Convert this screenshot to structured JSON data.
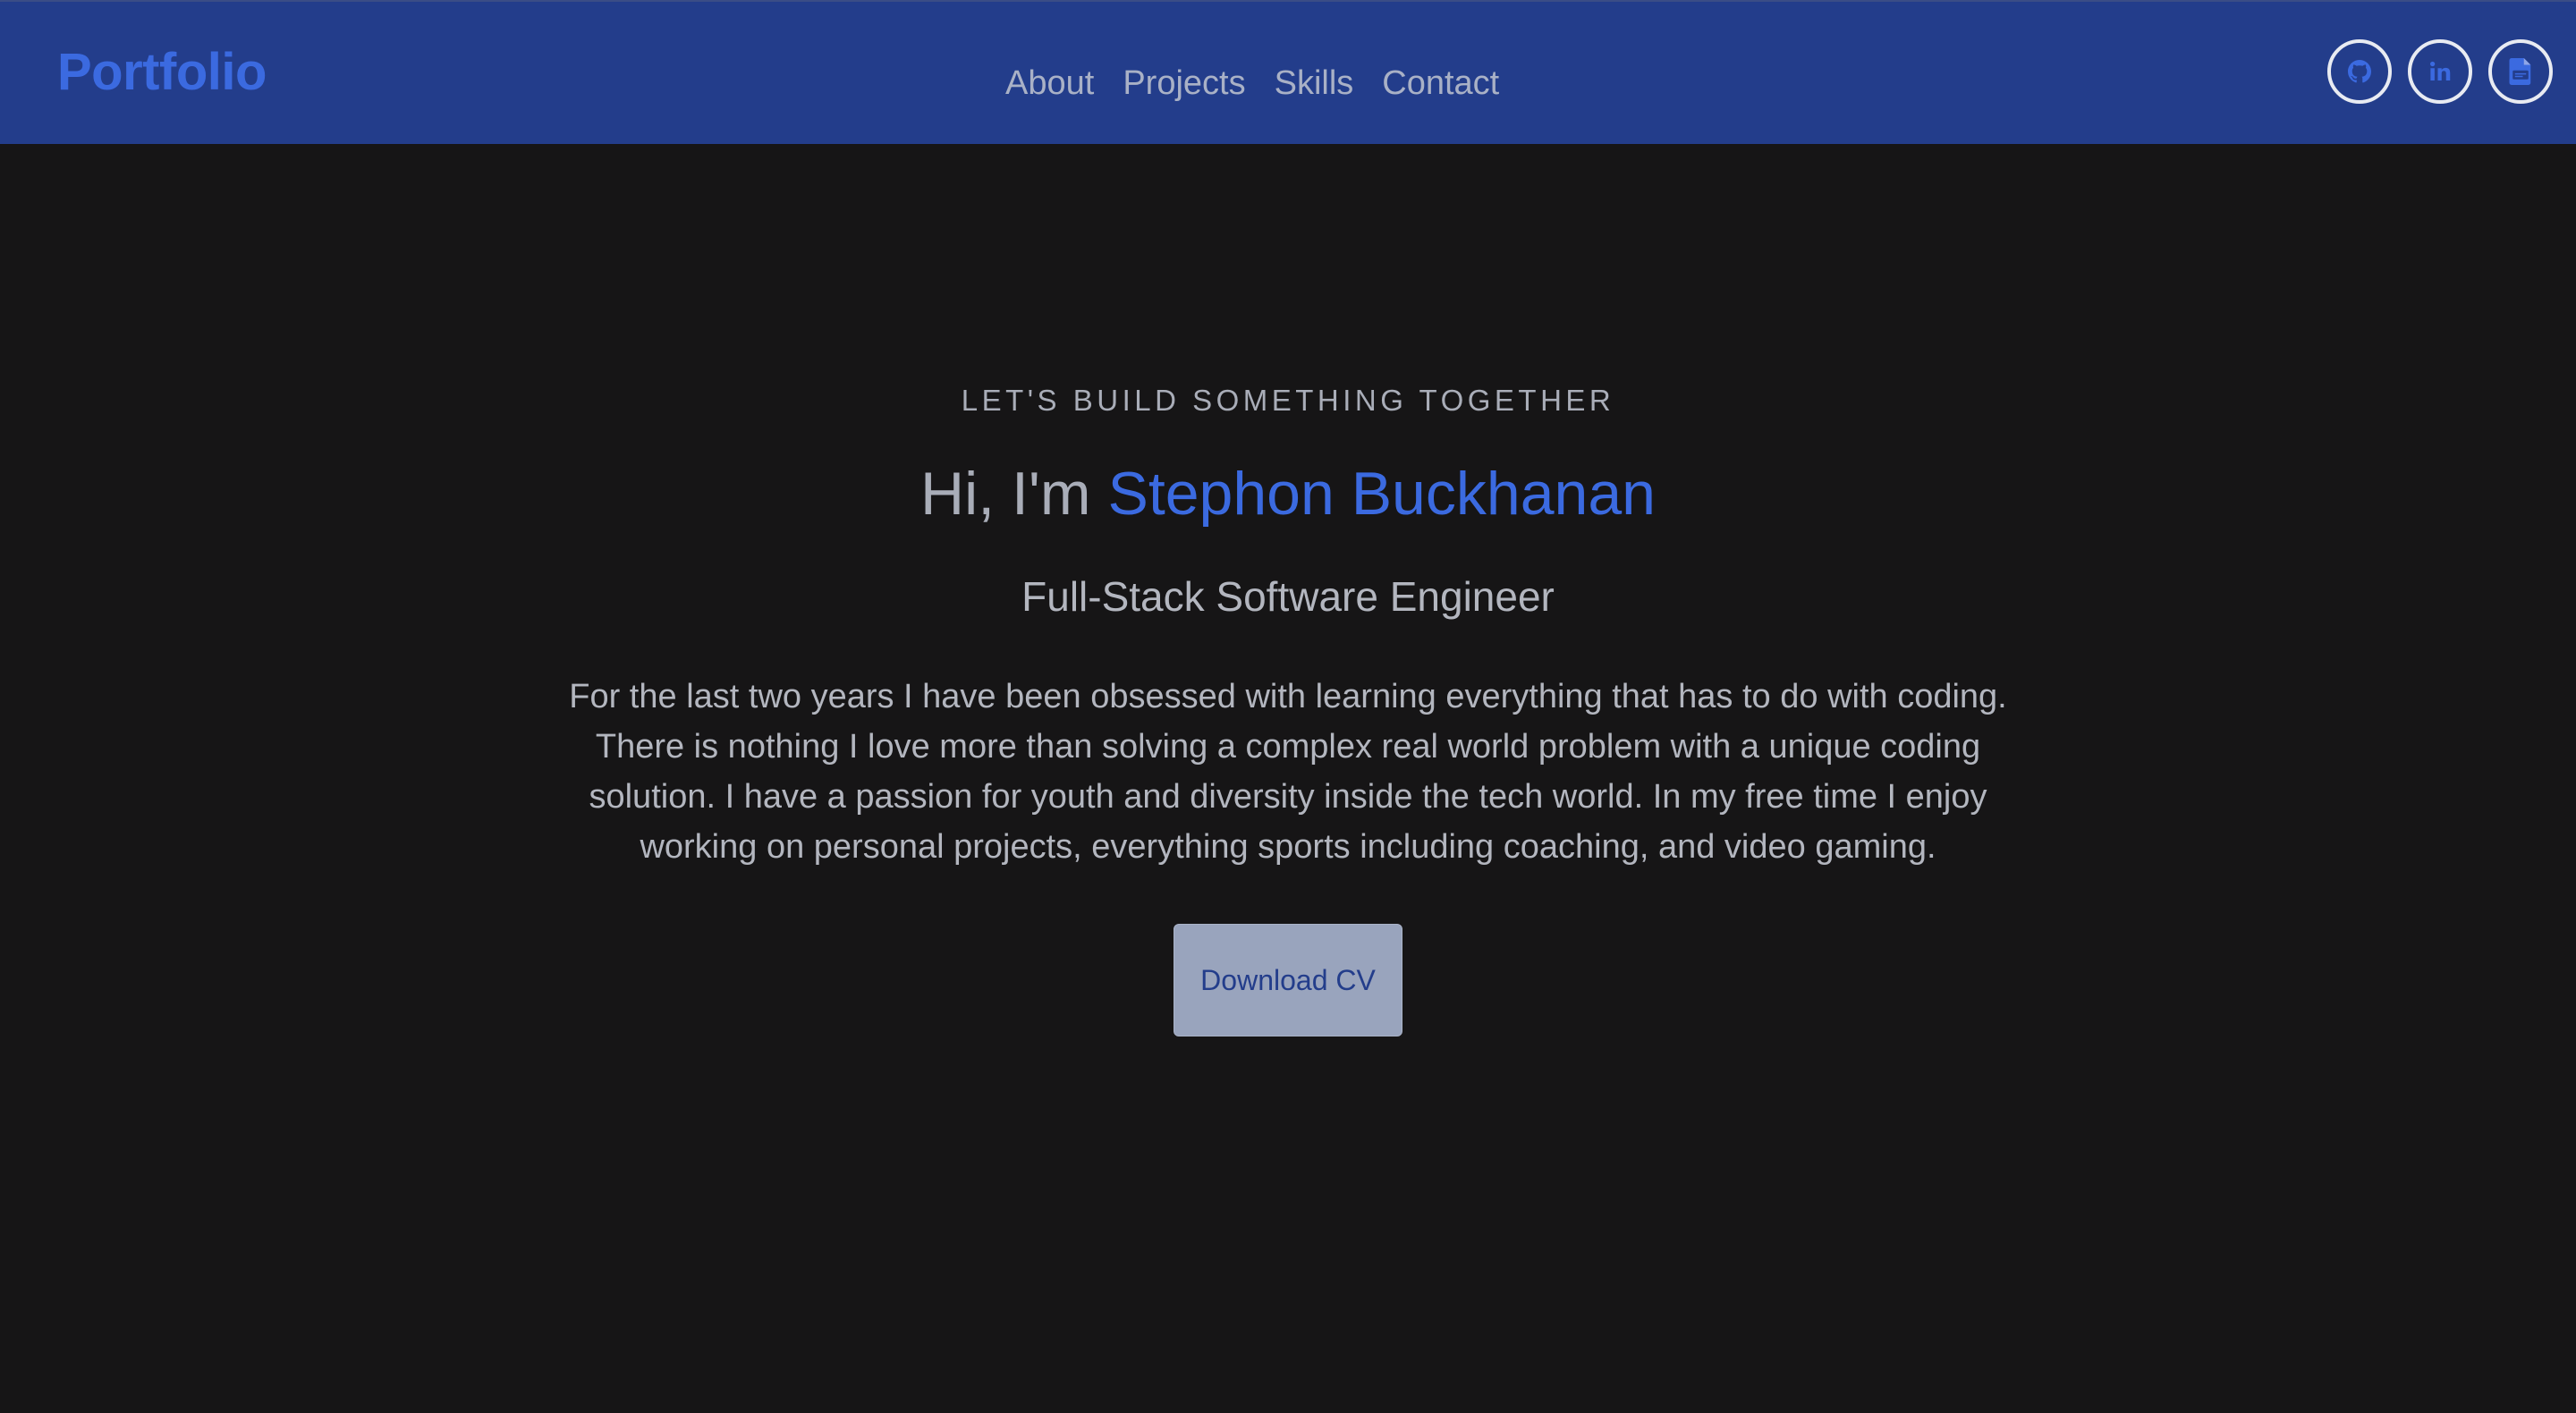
{
  "brand": {
    "label": "Portfolio"
  },
  "nav": {
    "items": [
      {
        "label": "About"
      },
      {
        "label": "Projects"
      },
      {
        "label": "Skills"
      },
      {
        "label": "Contact"
      }
    ]
  },
  "socials": [
    {
      "icon": "github-icon"
    },
    {
      "icon": "linkedin-icon"
    },
    {
      "icon": "cv-document-icon"
    }
  ],
  "hero": {
    "eyebrow": "LET'S BUILD SOMETHING TOGETHER",
    "greeting": "Hi, I'm",
    "name": "Stephon Buckhanan",
    "role": "Full-Stack Software Engineer",
    "bio": "For the last two years I have been obsessed with learning everything that has to do with coding. There is nothing I love more than solving a complex real world problem with a unique coding solution. I have a passion for youth and diversity inside the tech world. In my free time I enjoy working on personal projects, everything sports including coaching, and video gaming.",
    "cta_label": "Download CV"
  },
  "colors": {
    "navbar_bg": "#233d8b",
    "page_bg": "#161516",
    "accent": "#3b6ae0",
    "muted_text": "#a9adb8",
    "button_bg": "#99a4bd"
  }
}
